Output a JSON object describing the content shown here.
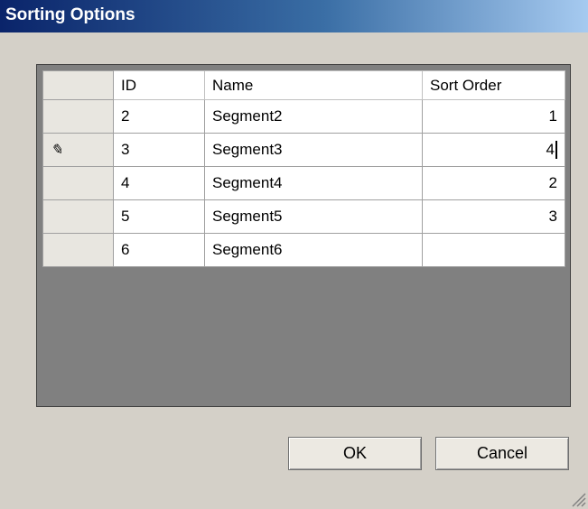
{
  "window": {
    "title": "Sorting Options"
  },
  "table": {
    "columns": [
      "",
      "ID",
      "Name",
      "Sort Order"
    ],
    "rows": [
      {
        "indicator": "",
        "id": "2",
        "name": "Segment2",
        "sort_order": "1"
      },
      {
        "indicator": "✎",
        "id": "3",
        "name": "Segment3",
        "sort_order": "4"
      },
      {
        "indicator": "",
        "id": "4",
        "name": "Segment4",
        "sort_order": "2"
      },
      {
        "indicator": "",
        "id": "5",
        "name": "Segment5",
        "sort_order": "3"
      },
      {
        "indicator": "",
        "id": "6",
        "name": "Segment6",
        "sort_order": ""
      }
    ]
  },
  "buttons": {
    "ok": "OK",
    "cancel": "Cancel"
  },
  "icons": {
    "edit_row": "pencil-icon",
    "resize": "resize-grip-icon"
  }
}
